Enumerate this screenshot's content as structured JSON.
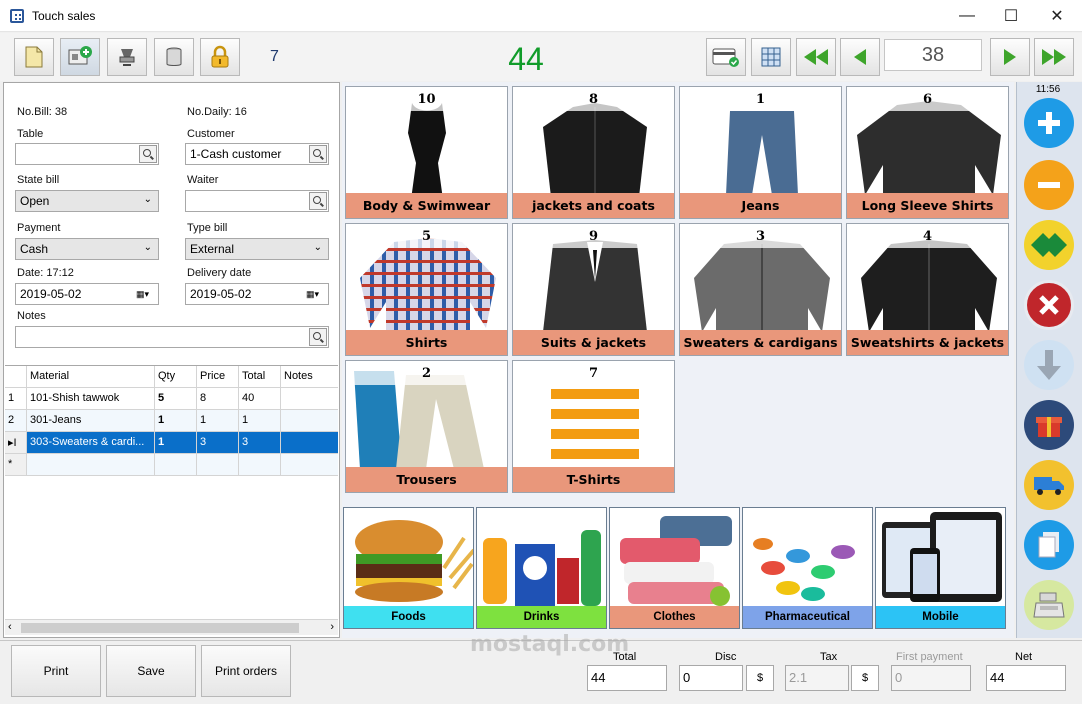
{
  "window": {
    "title": "Touch sales",
    "minimize": "—",
    "maximize": "☐",
    "close": "✕"
  },
  "toolbar": {
    "count": "7",
    "big_number": "44",
    "page": "38"
  },
  "form": {
    "no_bill": "No.Bill: 38",
    "no_daily": "No.Daily: 16",
    "table_label": "Table",
    "table_value": "",
    "customer_label": "Customer",
    "customer_value": "1-Cash customer",
    "state_label": "State bill",
    "state_value": "Open",
    "waiter_label": "Waiter",
    "waiter_value": "",
    "payment_label": "Payment",
    "payment_value": "Cash",
    "typebill_label": "Type bill",
    "typebill_value": "External",
    "date_label": "Date: 17:12",
    "date_value": "2019-05-02",
    "delivery_label": "Delivery date",
    "delivery_value": "2019-05-02",
    "notes_label": "Notes",
    "notes_value": ""
  },
  "grid": {
    "headers": [
      "",
      "Material",
      "Qty",
      "Price",
      "Total",
      "Notes"
    ],
    "rows": [
      {
        "idx": "1",
        "material": "101-Shish tawwok",
        "qty": "5",
        "price": "8",
        "total": "40",
        "notes": ""
      },
      {
        "idx": "2",
        "material": "301-Jeans",
        "qty": "1",
        "price": "1",
        "total": "1",
        "notes": ""
      },
      {
        "idx": "▸I",
        "material": "303-Sweaters & cardi...",
        "qty": "1",
        "price": "3",
        "total": "3",
        "notes": ""
      },
      {
        "idx": "*",
        "material": "",
        "qty": "",
        "price": "",
        "total": "",
        "notes": ""
      }
    ]
  },
  "products": [
    {
      "num": "10",
      "name": "Body & Swimwear"
    },
    {
      "num": "8",
      "name": "jackets and coats"
    },
    {
      "num": "1",
      "name": "Jeans"
    },
    {
      "num": "6",
      "name": "Long Sleeve Shirts"
    },
    {
      "num": "5",
      "name": "Shirts"
    },
    {
      "num": "9",
      "name": "Suits & jackets"
    },
    {
      "num": "3",
      "name": "Sweaters & cardigans"
    },
    {
      "num": "4",
      "name": "Sweatshirts & jackets"
    },
    {
      "num": "2",
      "name": "Trousers"
    },
    {
      "num": "7",
      "name": "T-Shirts"
    }
  ],
  "categories": [
    {
      "name": "Foods",
      "color": "#3fe0f0"
    },
    {
      "name": "Drinks",
      "color": "#7ee13f"
    },
    {
      "name": "Clothes",
      "color": "#e9977b"
    },
    {
      "name": "Pharmaceutical",
      "color": "#7ea3e9"
    },
    {
      "name": "Mobile",
      "color": "#2cc3f5"
    }
  ],
  "sidebar": {
    "clock": "11:56"
  },
  "footer": {
    "print": "Print",
    "save": "Save",
    "print_orders": "Print orders",
    "total_label": "Total",
    "total_value": "44",
    "disc_label": "Disc",
    "disc_value": "0",
    "disc_currency": "$",
    "tax_label": "Tax",
    "tax_value": "2.1",
    "tax_currency": "$",
    "first_payment_label": "First payment",
    "first_payment_value": "0",
    "net_label": "Net",
    "net_value": "44"
  },
  "watermark": "mostaql.com"
}
